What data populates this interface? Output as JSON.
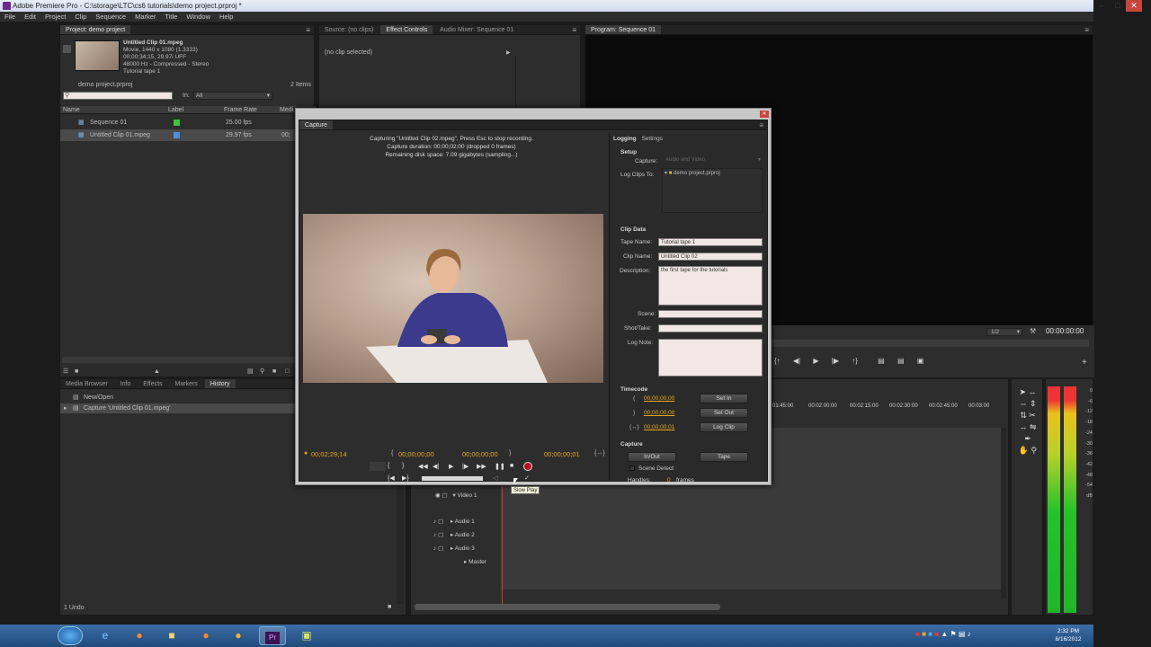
{
  "window": {
    "title": "Adobe Premiere Pro - C:\\storage\\LTC\\cs6 tutorials\\demo project.prproj *"
  },
  "menu": [
    "File",
    "Edit",
    "Project",
    "Clip",
    "Sequence",
    "Marker",
    "Title",
    "Window",
    "Help"
  ],
  "project_panel": {
    "tab": "Project: demo project",
    "clip_name": "Untitled Clip 01.mpeg",
    "clip_info": [
      "Movie, 1440 x 1080 (1.3333)",
      "00;00;34;15, 29.97i UFF",
      "48000 Hz - Compressed - Stereo",
      "Tutorial tape 1"
    ],
    "project_file": "demo project.prproj",
    "item_count": "2 Items",
    "in_label": "In:",
    "in_value": "All",
    "columns": [
      "Name",
      "Label",
      "Frame Rate",
      "Medi"
    ],
    "items": [
      {
        "name": "Sequence 01",
        "label_color": "#3ec43e",
        "rate": "25.00 fps",
        "extra": ""
      },
      {
        "name": "Untitled Clip 01.mpeg",
        "label_color": "#4f8fd8",
        "rate": "29.97 fps",
        "extra": "00;"
      }
    ]
  },
  "source_panel": {
    "tabs": [
      "Source: (no clips)",
      "Effect Controls",
      "Audio Mixer: Sequence 01"
    ],
    "no_clip": "(no clip selected)"
  },
  "program_panel": {
    "tab": "Program: Sequence 01",
    "zoom": "1/2",
    "timecode": "00:00:00:00"
  },
  "history_panel": {
    "tabs": [
      "Media Browser",
      "Info",
      "Effects",
      "Markers",
      "History"
    ],
    "items": [
      "New/Open",
      "Capture 'Untitled Clip 01.mpeg'"
    ],
    "status": "1 Undo"
  },
  "capture": {
    "tab": "Capture",
    "status_lines": [
      "Capturing \"Untitled Clip 02.mpeg\", Press Esc to stop recording.",
      "Capture duration: 00;00;02;00 (dropped 0 frames)",
      "Remaining disk space: 7.09 gigabytes (sampling...)"
    ],
    "tc_current": "00;02;29;14",
    "tc_in": "00;00;00;00",
    "tc_out": "00;00;00;00",
    "tc_duration": "00;00;00;01",
    "tooltip": "Slow Play",
    "settings_tabs": [
      "Logging",
      "Settings"
    ],
    "setup_title": "Setup",
    "capture_label": "Capture:",
    "capture_value": "Audio and Video",
    "log_clips_label": "Log Clips To:",
    "log_clips_value": "demo project.prproj",
    "clip_data_title": "Clip Data",
    "tape_name_label": "Tape Name:",
    "tape_name": "Tutorial tape 1",
    "clip_name_label": "Clip Name:",
    "clip_name": "Untitled Clip 02",
    "description_label": "Description:",
    "description": "the first tape for the tutorials",
    "scene_label": "Scene:",
    "shot_label": "Shot/Take:",
    "log_note_label": "Log Note:",
    "timecode_title": "Timecode",
    "set_in_tc": "00;00;00;00",
    "set_out_tc": "00;00;00;00",
    "dur_tc": "00;00;00;01",
    "set_in_btn": "Set In",
    "set_out_btn": "Set Out",
    "log_clip_btn": "Log Clip",
    "capture_title": "Capture",
    "inout_btn": "In/Out",
    "tape_btn": "Tape",
    "scene_detect": "Scene Detect",
    "handles_label": "Handles:",
    "handles_value": "0",
    "handles_unit": "frames"
  },
  "timeline": {
    "ruler": [
      "01:45:00",
      "00:02:00:00",
      "00:02:15:00",
      "00:02:30:00",
      "00:02:45:00",
      "00:03:00"
    ],
    "tracks": [
      "Video 1",
      "Audio 1",
      "Audio 2",
      "Audio 3",
      "Master"
    ]
  },
  "meters": {
    "scale": [
      "0",
      "-6",
      "-12",
      "-18",
      "-24",
      "-30",
      "-36",
      "-42",
      "-48",
      "-54",
      "dB"
    ]
  },
  "taskbar": {
    "time": "2:32 PM",
    "date": "8/16/2012",
    "apps": [
      "start-orb",
      "ie",
      "firefox",
      "folder",
      "firefox2",
      "firefox3",
      "premiere",
      "media"
    ]
  },
  "colors": {
    "accent_timecode": "#e5a81e",
    "panel": "#2d2d2d"
  }
}
